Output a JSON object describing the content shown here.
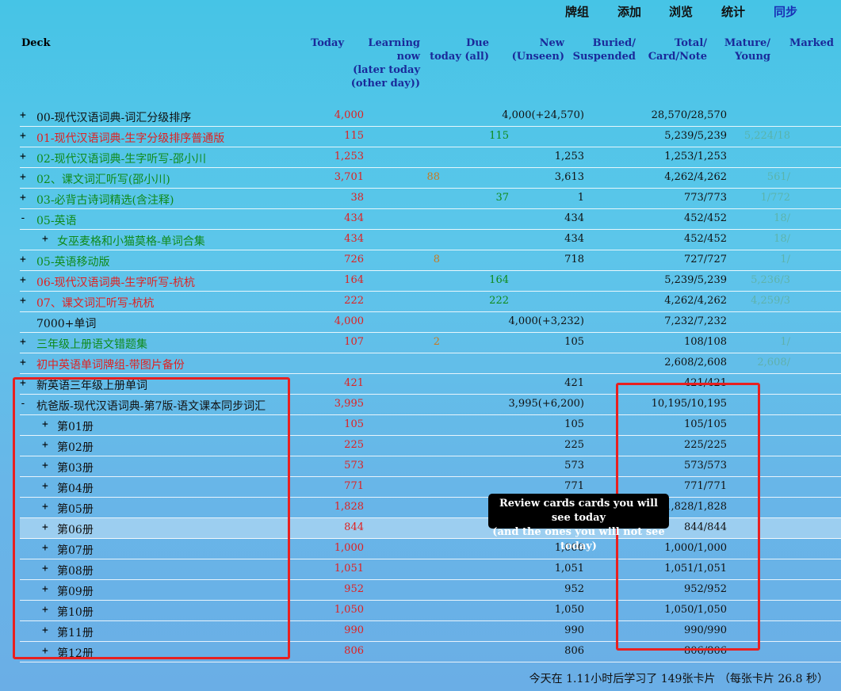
{
  "nav": {
    "decks": "牌组",
    "add": "添加",
    "browse": "浏览",
    "stats": "统计",
    "sync": "同步"
  },
  "headers": {
    "deck": "Deck",
    "today": "Today",
    "learning_line1": "Learning",
    "learning_line2": "now",
    "learning_line3": "(later today",
    "learning_line4": "(other day))",
    "due_line1": "Due",
    "due_line2": "today (all)",
    "new_line1": "New",
    "new_line2": "(Unseen)",
    "buried_line1": "Buried/",
    "buried_line2": "Suspended",
    "total_line1": "Total/",
    "total_line2": "Card/Note",
    "mature_line1": "Mature/",
    "mature_line2": "Young",
    "marked": "Marked"
  },
  "rows": [
    {
      "toggle": "+",
      "name": "00-现代汉语词典-词汇分级排序",
      "name_color": "black",
      "today": "4,000",
      "learning": "",
      "due": "",
      "new": "4,000(+24,570)",
      "total": "28,570/28,570",
      "mature": "",
      "sub": false
    },
    {
      "toggle": "+",
      "name": "01-现代汉语词典-生字分级排序普通版",
      "name_color": "red",
      "today": "115",
      "learning": "",
      "due": "115",
      "new": "",
      "total": "5,239/5,239",
      "mature": "5,224/18",
      "sub": false
    },
    {
      "toggle": "+",
      "name": "02-现代汉语词典-生字听写-邵小川",
      "name_color": "green",
      "today": "1,253",
      "learning": "",
      "due": "",
      "new": "1,253",
      "total": "1,253/1,253",
      "mature": "",
      "sub": false
    },
    {
      "toggle": "+",
      "name": "02、课文词汇听写(邵小川)",
      "name_color": "green",
      "today": "3,701",
      "learning": "88",
      "due": "",
      "new": "3,613",
      "total": "4,262/4,262",
      "mature": "561/",
      "sub": false
    },
    {
      "toggle": "+",
      "name": "03-必背古诗词精选(含注释)",
      "name_color": "green",
      "today": "38",
      "learning": "",
      "due": "37",
      "new": "1",
      "total": "773/773",
      "mature": "1/772",
      "sub": false
    },
    {
      "toggle": "-",
      "name": "05-英语",
      "name_color": "green",
      "today": "434",
      "learning": "",
      "due": "",
      "new": "434",
      "total": "452/452",
      "mature": "18/",
      "sub": false
    },
    {
      "toggle": "+",
      "name": "女巫麦格和小猫莫格-单词合集",
      "name_color": "green",
      "today": "434",
      "learning": "",
      "due": "",
      "new": "434",
      "total": "452/452",
      "mature": "18/",
      "sub": true
    },
    {
      "toggle": "+",
      "name": "05-英语移动版",
      "name_color": "green",
      "today": "726",
      "learning": "8",
      "due": "",
      "new": "718",
      "total": "727/727",
      "mature": "1/",
      "sub": false
    },
    {
      "toggle": "+",
      "name": "06-现代汉语词典-生字听写-杭杭",
      "name_color": "red",
      "today": "164",
      "learning": "",
      "due": "164",
      "new": "",
      "total": "5,239/5,239",
      "mature": "5,236/3",
      "sub": false
    },
    {
      "toggle": "+",
      "name": "07、课文词汇听写-杭杭",
      "name_color": "red",
      "today": "222",
      "learning": "",
      "due": "222",
      "new": "",
      "total": "4,262/4,262",
      "mature": "4,259/3",
      "sub": false
    },
    {
      "toggle": "",
      "name": "7000+单词",
      "name_color": "black",
      "today": "4,000",
      "learning": "",
      "due": "",
      "new": "4,000(+3,232)",
      "total": "7,232/7,232",
      "mature": "",
      "sub": false
    },
    {
      "toggle": "+",
      "name": "三年级上册语文错题集",
      "name_color": "green",
      "today": "107",
      "learning": "2",
      "due": "",
      "new": "105",
      "total": "108/108",
      "mature": "1/",
      "sub": false
    },
    {
      "toggle": "+",
      "name": "初中英语单词牌组-带图片备份",
      "name_color": "red",
      "today": "",
      "learning": "",
      "due": "",
      "new": "",
      "total": "2,608/2,608",
      "mature": "2,608/",
      "sub": false
    },
    {
      "toggle": "+",
      "name": "新英语三年级上册单词",
      "name_color": "black",
      "today": "421",
      "learning": "",
      "due": "",
      "new": "421",
      "total": "421/421",
      "mature": "",
      "sub": false
    },
    {
      "toggle": "-",
      "name": "杭爸版-现代汉语词典-第7版-语文课本同步词汇",
      "name_color": "black",
      "today": "3,995",
      "learning": "",
      "due": "",
      "new": "3,995(+6,200)",
      "total": "10,195/10,195",
      "mature": "",
      "sub": false
    },
    {
      "toggle": "+",
      "name": "第01册",
      "name_color": "black",
      "today": "105",
      "learning": "",
      "due": "",
      "new": "105",
      "total": "105/105",
      "mature": "",
      "sub": true
    },
    {
      "toggle": "+",
      "name": "第02册",
      "name_color": "black",
      "today": "225",
      "learning": "",
      "due": "",
      "new": "225",
      "total": "225/225",
      "mature": "",
      "sub": true
    },
    {
      "toggle": "+",
      "name": "第03册",
      "name_color": "black",
      "today": "573",
      "learning": "",
      "due": "",
      "new": "573",
      "total": "573/573",
      "mature": "",
      "sub": true
    },
    {
      "toggle": "+",
      "name": "第04册",
      "name_color": "black",
      "today": "771",
      "learning": "",
      "due": "",
      "new": "771",
      "total": "771/771",
      "mature": "",
      "sub": true
    },
    {
      "toggle": "+",
      "name": "第05册",
      "name_color": "black",
      "today": "1,828",
      "learning": "",
      "due": "",
      "new": "1,828",
      "total": "1,828/1,828",
      "mature": "",
      "sub": true
    },
    {
      "toggle": "+",
      "name": "第06册",
      "name_color": "black",
      "today": "844",
      "learning": "",
      "due": "",
      "new": "",
      "total": "844/844",
      "mature": "",
      "sub": true,
      "highlight": true
    },
    {
      "toggle": "+",
      "name": "第07册",
      "name_color": "black",
      "today": "1,000",
      "learning": "",
      "due": "",
      "new": "1,000",
      "total": "1,000/1,000",
      "mature": "",
      "sub": true
    },
    {
      "toggle": "+",
      "name": "第08册",
      "name_color": "black",
      "today": "1,051",
      "learning": "",
      "due": "",
      "new": "1,051",
      "total": "1,051/1,051",
      "mature": "",
      "sub": true
    },
    {
      "toggle": "+",
      "name": "第09册",
      "name_color": "black",
      "today": "952",
      "learning": "",
      "due": "",
      "new": "952",
      "total": "952/952",
      "mature": "",
      "sub": true
    },
    {
      "toggle": "+",
      "name": "第10册",
      "name_color": "black",
      "today": "1,050",
      "learning": "",
      "due": "",
      "new": "1,050",
      "total": "1,050/1,050",
      "mature": "",
      "sub": true
    },
    {
      "toggle": "+",
      "name": "第11册",
      "name_color": "black",
      "today": "990",
      "learning": "",
      "due": "",
      "new": "990",
      "total": "990/990",
      "mature": "",
      "sub": true
    },
    {
      "toggle": "+",
      "name": "第12册",
      "name_color": "black",
      "today": "806",
      "learning": "",
      "due": "",
      "new": "806",
      "total": "806/806",
      "mature": "",
      "sub": true
    }
  ],
  "tooltip": {
    "line1": "Review cards cards you will see today",
    "line2": "(and the ones you will not see today)"
  },
  "footer": "今天在 1.11小时后学习了 149张卡片 （每张卡片 26.8 秒）",
  "colors": {
    "annotation_box": "#e82020",
    "today_count": "#e02020",
    "learning_count": "#c87a20",
    "due_count": "#0f8a1a",
    "sync_active": "#1a2fb5"
  }
}
